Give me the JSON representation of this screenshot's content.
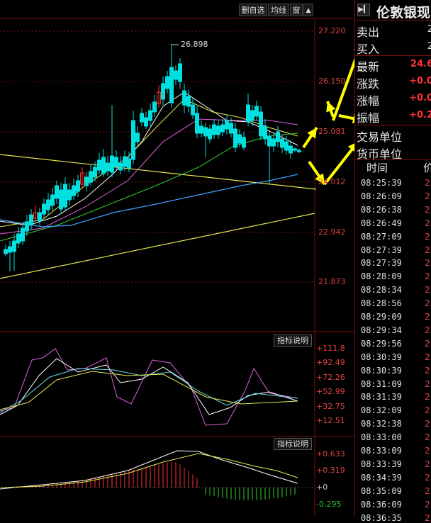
{
  "toolbar": {
    "delete_watchlist": "删自选",
    "ma_line": "均线",
    "window": "窗"
  },
  "price_axis": [
    "27.220",
    "26.150",
    "25.081",
    "24.012",
    "22.942",
    "21.873"
  ],
  "peak_label": "26.898",
  "indicator_button_1": "指标说明",
  "indicator_button_2": "指标说明",
  "ind1_axis": [
    "+111.8",
    "+92.49",
    "+72.26",
    "+52.99",
    "+32.75",
    "+12.51"
  ],
  "ind2_axis": [
    "+0.633",
    "+0.319",
    "+0",
    "-0.295"
  ],
  "colors": {
    "up": "#ff3030",
    "down": "#00e0e0",
    "arrow": "#ffff00",
    "background": "#000000"
  },
  "panel": {
    "title": "伦敦银现",
    "collapse_icon": "collapse-arrow-icon",
    "sell_label": "卖出",
    "sell_value": "2",
    "buy_label": "买入",
    "buy_value": "2",
    "latest_label": "最新",
    "latest_value": "24.6",
    "change_label": "涨跌",
    "change_value": "+0.0",
    "change_pct_label": "涨幅",
    "change_pct_value": "+0.0",
    "amplitude_label": "振幅",
    "amplitude_value": "+0.2",
    "trade_unit_label": "交易单位",
    "currency_unit_label": "货币单位",
    "time_header": "时间",
    "price_header": "价"
  },
  "ticks": [
    {
      "time": "08:25:39",
      "price": "2"
    },
    {
      "time": "08:26:09",
      "price": "2"
    },
    {
      "time": "08:26:38",
      "price": "2"
    },
    {
      "time": "08:26:49",
      "price": "2"
    },
    {
      "time": "08:27:09",
      "price": "2"
    },
    {
      "time": "08:27:39",
      "price": "2"
    },
    {
      "time": "08:27:39",
      "price": "2"
    },
    {
      "time": "08:28:09",
      "price": "2"
    },
    {
      "time": "08:28:34",
      "price": "2"
    },
    {
      "time": "08:28:56",
      "price": "2"
    },
    {
      "time": "08:29:09",
      "price": "2"
    },
    {
      "time": "08:29:34",
      "price": "2"
    },
    {
      "time": "08:29:56",
      "price": "2"
    },
    {
      "time": "08:30:39",
      "price": "2"
    },
    {
      "time": "08:30:39",
      "price": "2"
    },
    {
      "time": "08:31:09",
      "price": "2"
    },
    {
      "time": "08:31:39",
      "price": "2"
    },
    {
      "time": "08:32:09",
      "price": "2"
    },
    {
      "time": "08:32:38",
      "price": "2"
    },
    {
      "time": "08:33:00",
      "price": "2"
    },
    {
      "time": "08:33:09",
      "price": "2"
    },
    {
      "time": "08:33:39",
      "price": "2"
    },
    {
      "time": "08:34:39",
      "price": "2"
    },
    {
      "time": "08:35:09",
      "price": "2"
    },
    {
      "time": "08:36:09",
      "price": "2"
    },
    {
      "time": "08:36:35",
      "price": "2"
    }
  ]
}
